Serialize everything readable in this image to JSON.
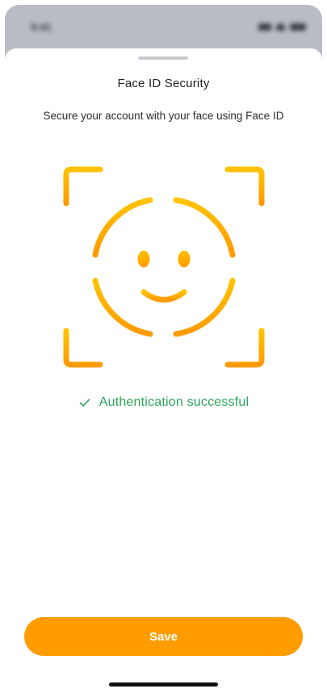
{
  "status_bar": {
    "time": "9:41"
  },
  "sheet": {
    "title": "Face ID Security",
    "subtitle": "Secure your account with your face using Face ID"
  },
  "face_id": {
    "icon": "face-id-icon",
    "gradient": [
      "#ffc300",
      "#ff9a00"
    ]
  },
  "auth_status": {
    "text": "Authentication successful",
    "icon": "checkmark-icon",
    "color": "#2ca45a"
  },
  "actions": {
    "save_label": "Save",
    "accent": "#ff9c00"
  }
}
